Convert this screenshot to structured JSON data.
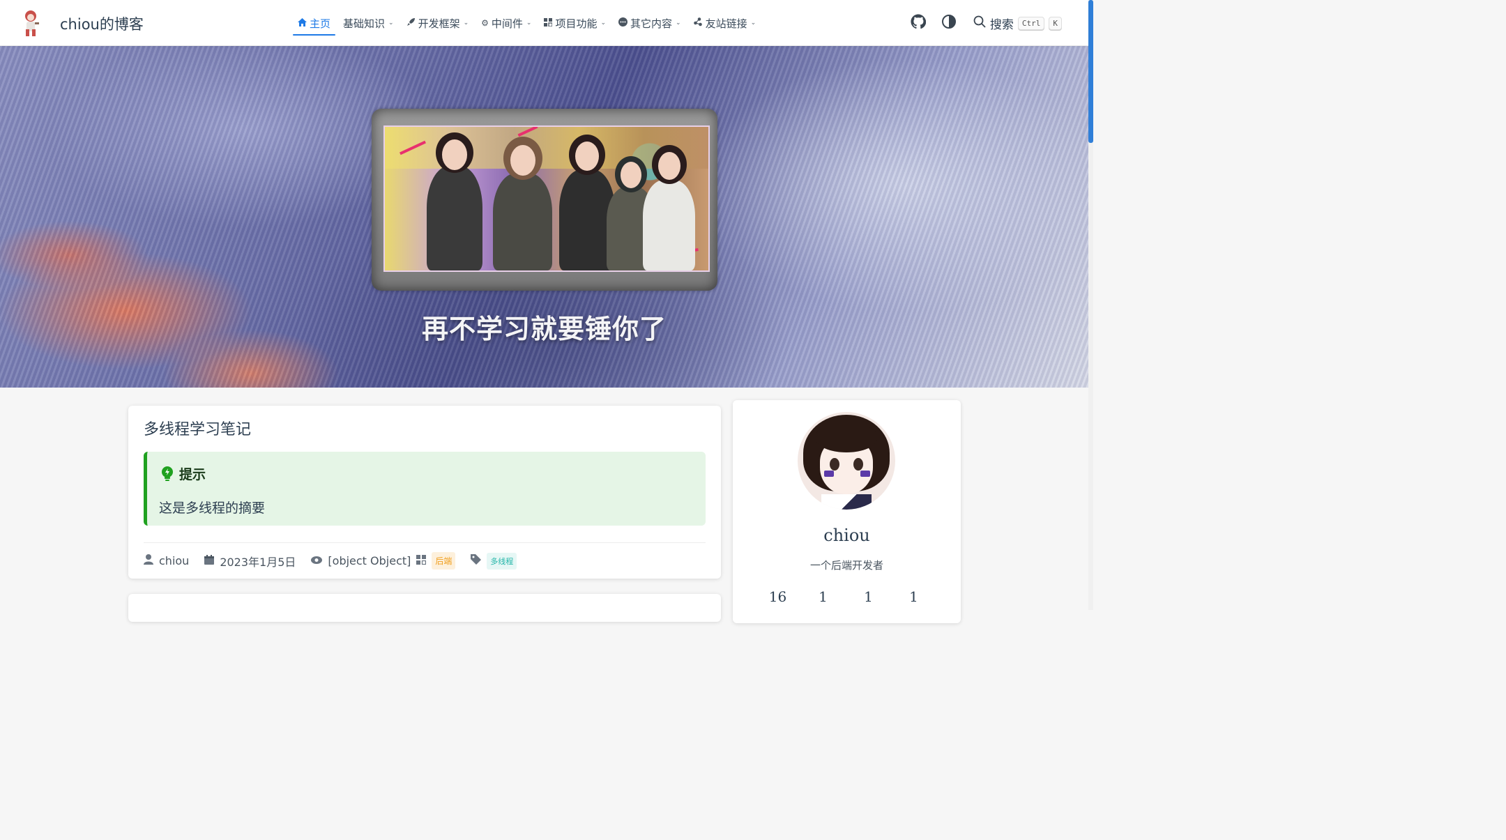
{
  "site": {
    "title": "chiou的博客"
  },
  "nav": {
    "items": [
      {
        "label": "主页",
        "icon": "home-icon"
      },
      {
        "label": "基础知识",
        "icon": null
      },
      {
        "label": "开发框架",
        "icon": "rocket-icon"
      },
      {
        "label": "中间件",
        "icon": "gear-icon"
      },
      {
        "label": "项目功能",
        "icon": "blocks-icon"
      },
      {
        "label": "其它内容",
        "icon": "dots-icon"
      },
      {
        "label": "友站链接",
        "icon": "share-icon"
      }
    ],
    "active_index": 0
  },
  "toolbar": {
    "search_label": "搜索",
    "search_key_1": "Ctrl",
    "search_key_2": "K",
    "icons": [
      "github-icon",
      "theme-toggle-icon",
      "search-icon"
    ]
  },
  "hero": {
    "motto": "再不学习就要锤你了"
  },
  "article": {
    "title": "多线程学习笔记",
    "tip_title": "提示",
    "tip_body": "这是多线程的摘要",
    "meta": {
      "author": "chiou",
      "date": "2023年1月5日",
      "views": "[object Object]",
      "category": "后端",
      "tag": "多线程"
    }
  },
  "profile": {
    "name": "chiou",
    "bio": "一个后端开发者",
    "stats": [
      "16",
      "1",
      "1",
      "1"
    ]
  },
  "colors": {
    "accent": "#1e7ae6",
    "tip_border": "#1fa11f",
    "tip_bg": "#e5f5e6",
    "category_tag": "#f0a020",
    "topic_tag": "#22b5a8",
    "scrollbar": "#2f7fd8"
  }
}
